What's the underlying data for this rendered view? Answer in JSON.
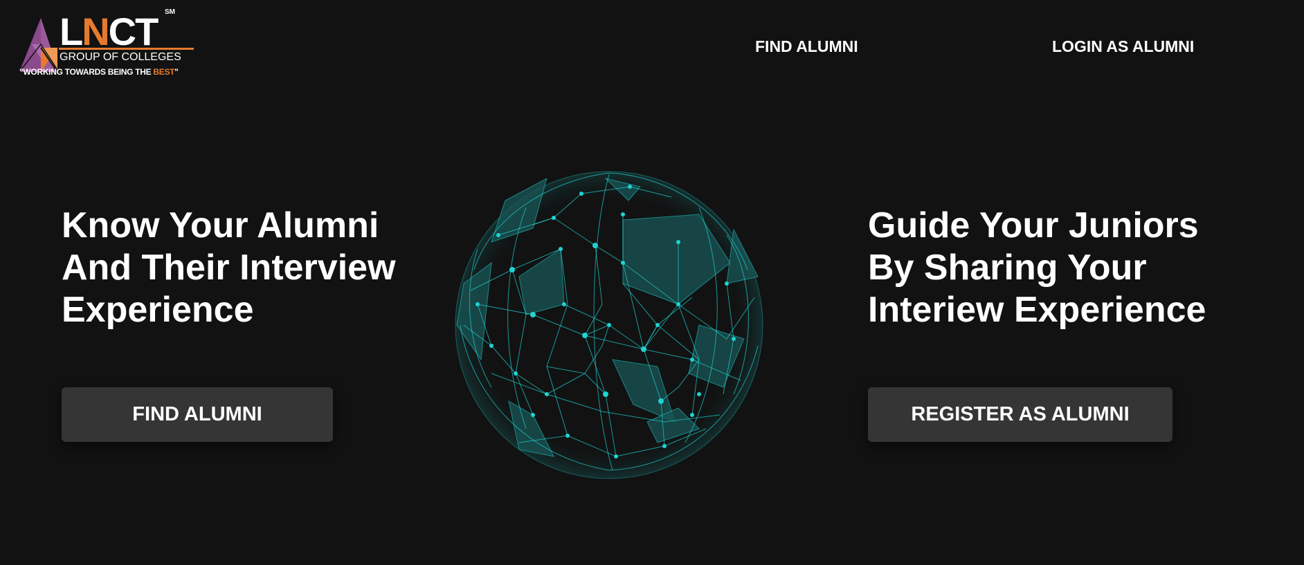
{
  "logo": {
    "word_part1": "L",
    "word_accent": "N",
    "word_part2": "CT",
    "trademark": "SM",
    "subtitle": "GROUP OF COLLEGES",
    "tagline_prefix": "\"WORKING TOWARDS BEING THE ",
    "tagline_highlight": "BEST",
    "tagline_suffix": "\"",
    "icon": "triangle-logo-icon"
  },
  "nav": {
    "find_alumni": "FIND ALUMNI",
    "login_as_alumni": "LOGIN AS ALUMNI"
  },
  "hero_left": {
    "line1": "Know Your Alumni",
    "line2": "And Their Interview",
    "line3": "Experience",
    "button": "FIND ALUMNI"
  },
  "hero_right": {
    "line1": "Guide Your Juniors",
    "line2": "By Sharing Your",
    "line3": "Interiew Experience",
    "button": "REGISTER AS ALUMNI"
  },
  "globe": {
    "icon": "network-globe-icon"
  },
  "colors": {
    "background": "#121212",
    "accent_orange": "#e67a2e",
    "button_bg": "#353535",
    "globe_cyan": "#1fd3d3",
    "logo_purple": "#8a4a8c"
  }
}
